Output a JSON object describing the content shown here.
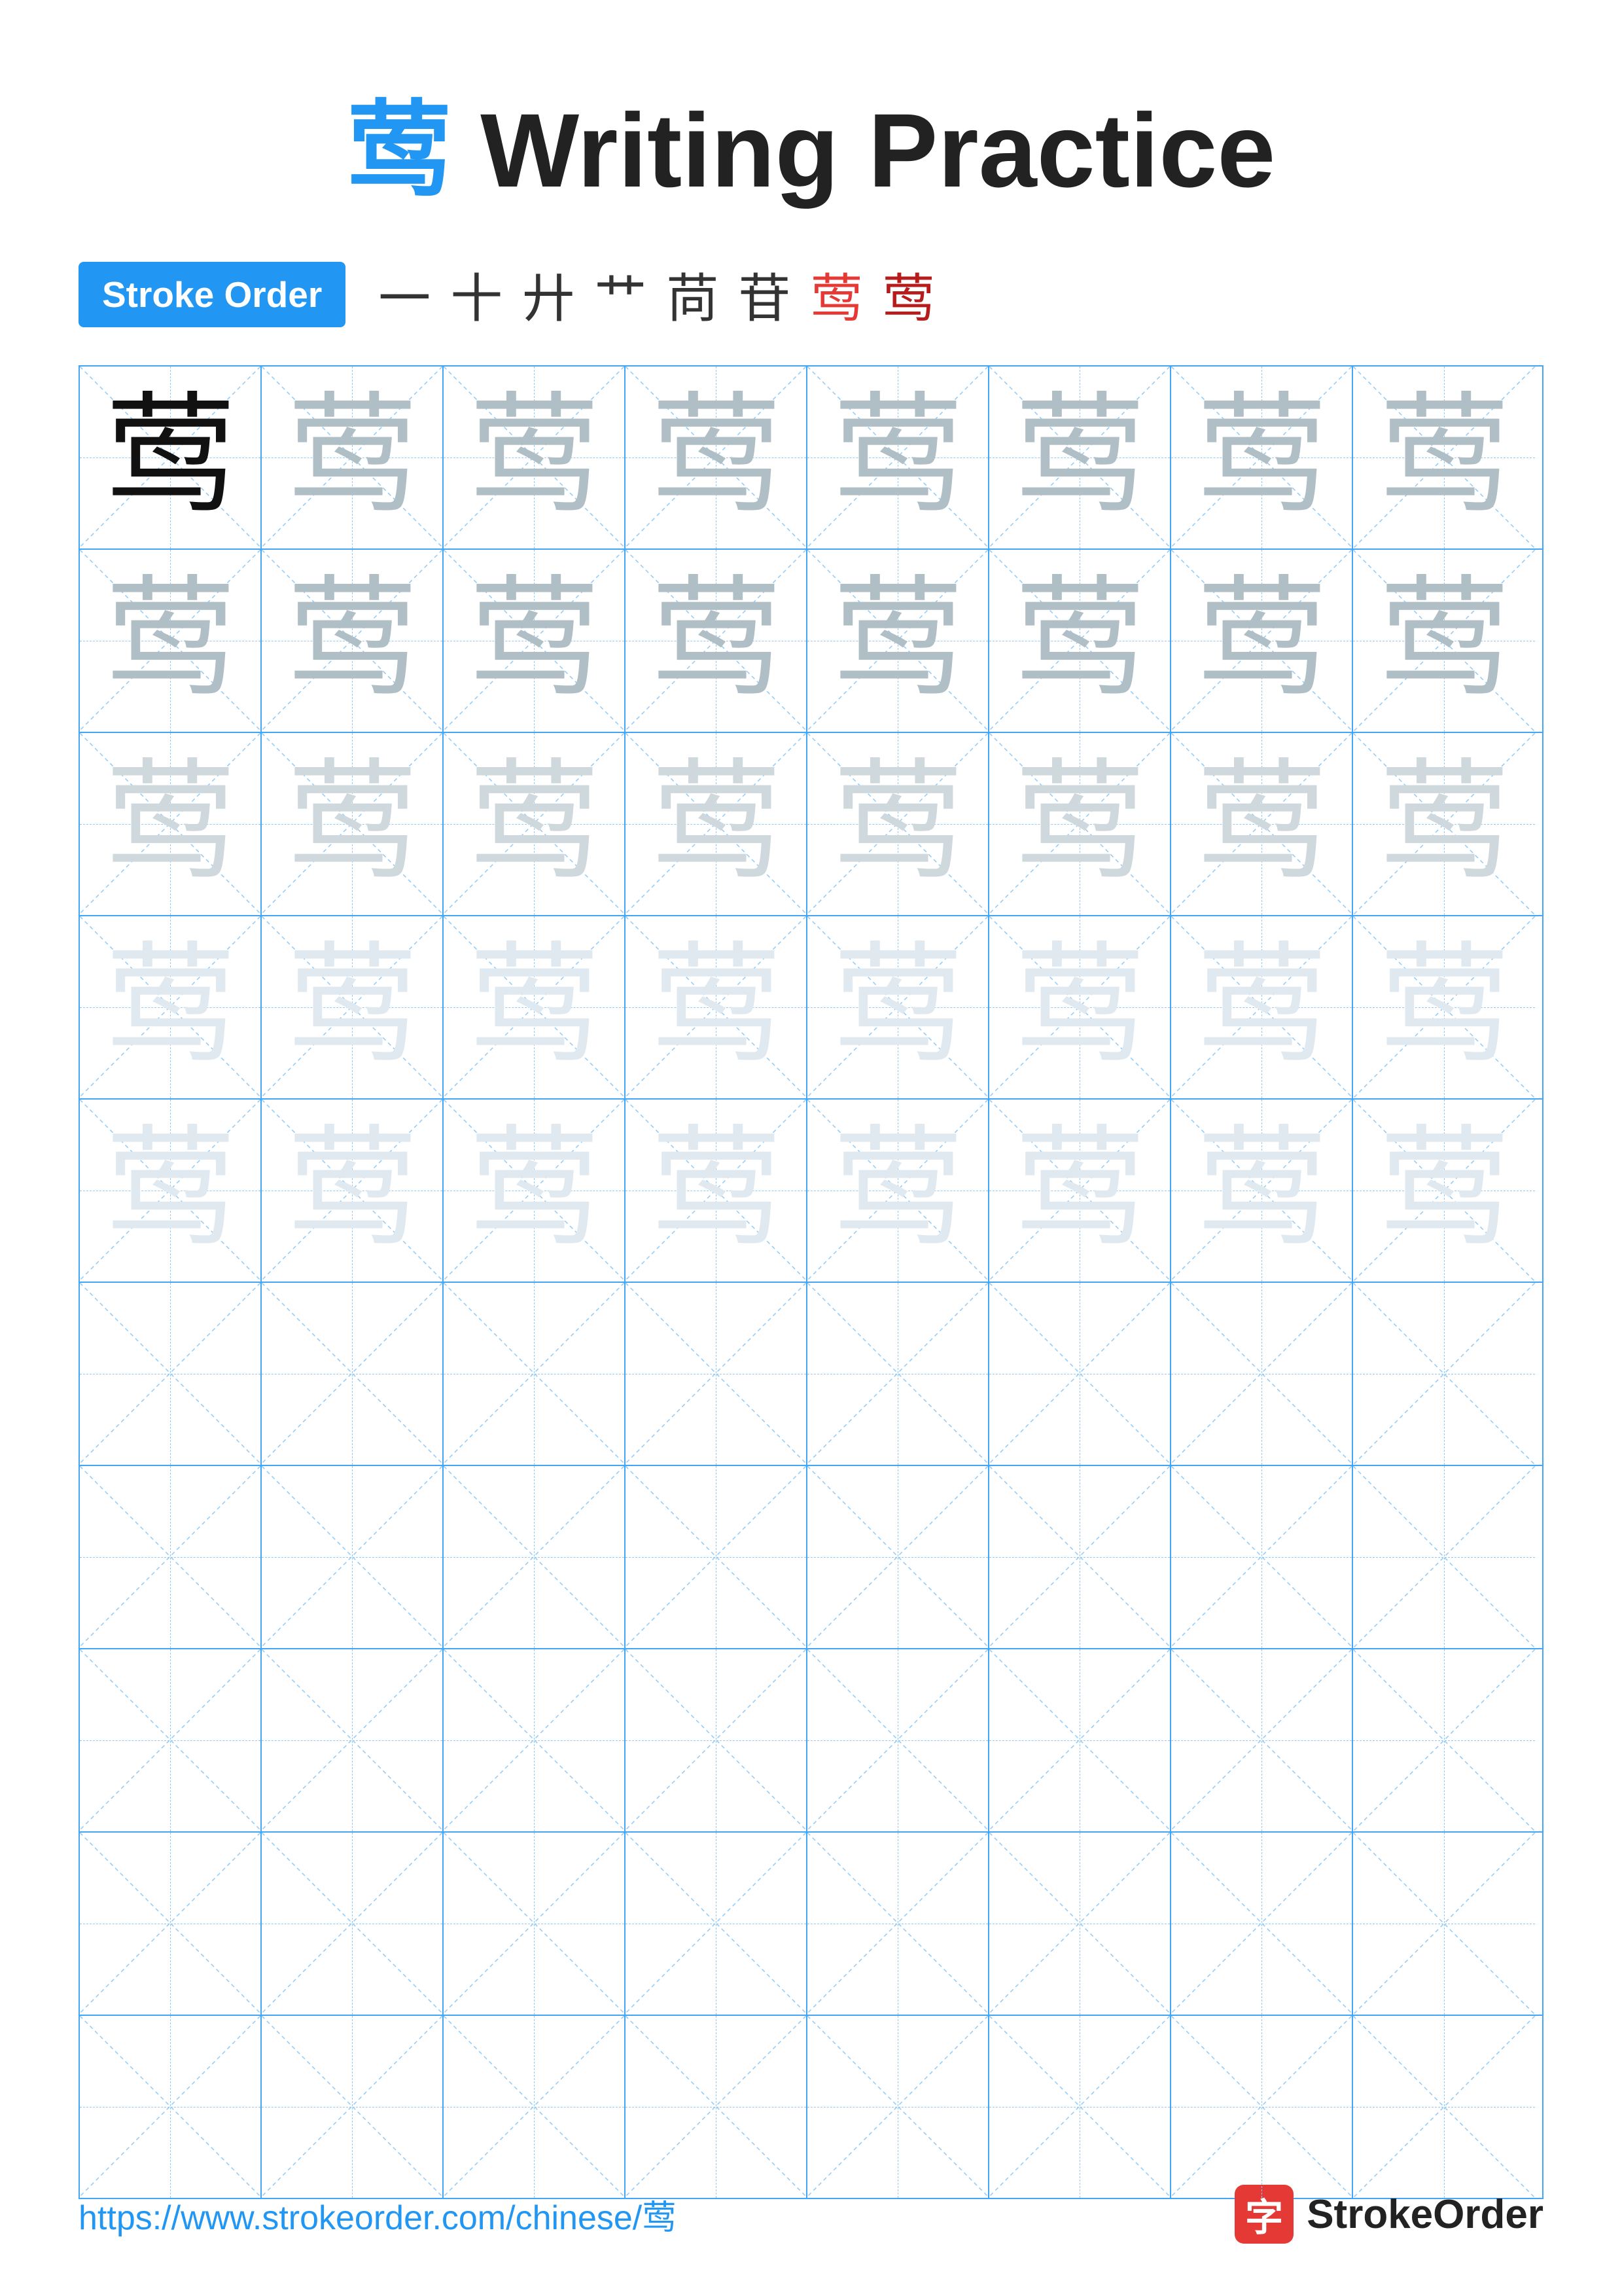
{
  "title": {
    "char": "莺",
    "text": " Writing Practice"
  },
  "stroke_order": {
    "badge_label": "Stroke Order",
    "steps": [
      "一",
      "十",
      "廾",
      "艹",
      "苘",
      "苷",
      "莺",
      "莺"
    ]
  },
  "grid": {
    "rows": 10,
    "cols": 8,
    "practice_char": "莺",
    "row_styles": [
      "dark",
      "medium",
      "medium",
      "light",
      "lighter",
      "empty",
      "empty",
      "empty",
      "empty",
      "empty"
    ]
  },
  "footer": {
    "url": "https://www.strokeorder.com/chinese/莺",
    "brand_icon": "字",
    "brand_name": "StrokeOrder"
  }
}
